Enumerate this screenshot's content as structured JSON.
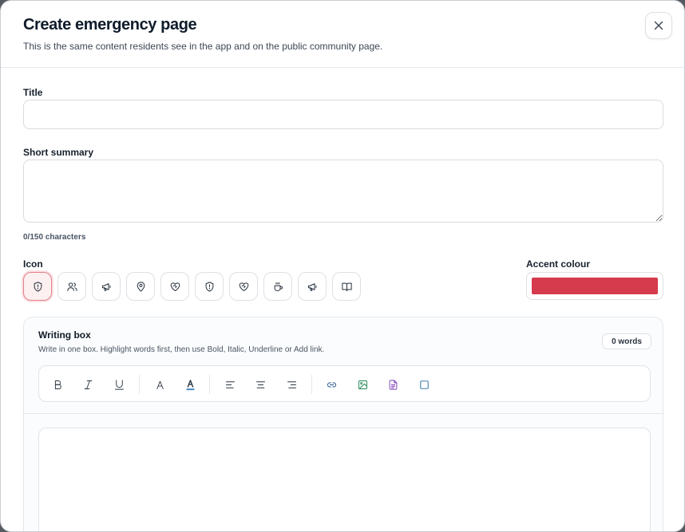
{
  "modal": {
    "title": "Create emergency page",
    "subtitle": "This is the same content residents see in the app and on the public community page."
  },
  "form": {
    "title_label": "Title",
    "title_value": "",
    "summary_label": "Short summary",
    "summary_value": "",
    "char_count": "0/150 characters",
    "icon_label": "Icon",
    "accent_label": "Accent colour",
    "accent_color": "#d63a4d",
    "icons": [
      {
        "name": "shield-alert-icon",
        "selected": true
      },
      {
        "name": "users-icon",
        "selected": false
      },
      {
        "name": "megaphone-icon",
        "selected": false
      },
      {
        "name": "map-pin-icon",
        "selected": false
      },
      {
        "name": "heart-handshake-icon",
        "selected": false
      },
      {
        "name": "shield-alert-icon",
        "selected": false
      },
      {
        "name": "heart-handshake-icon",
        "selected": false
      },
      {
        "name": "coffee-icon",
        "selected": false
      },
      {
        "name": "megaphone-icon",
        "selected": false
      },
      {
        "name": "book-open-icon",
        "selected": false
      }
    ]
  },
  "writing_box": {
    "title": "Writing box",
    "subtitle": "Write in one box. Highlight words first, then use Bold, Italic, Underline or Add link.",
    "word_count": "0 words",
    "toolbar": [
      {
        "name": "bold-icon",
        "glyph": "B"
      },
      {
        "name": "italic-icon",
        "glyph": "I"
      },
      {
        "name": "underline-icon",
        "glyph": "U"
      },
      {
        "name": "font-size-icon",
        "glyph": "A"
      },
      {
        "name": "text-color-icon",
        "glyph": "A"
      },
      {
        "name": "align-left-icon"
      },
      {
        "name": "align-center-icon"
      },
      {
        "name": "align-right-icon"
      },
      {
        "name": "link-icon"
      },
      {
        "name": "image-icon"
      },
      {
        "name": "document-icon"
      },
      {
        "name": "box-icon"
      }
    ],
    "text_color_accent": "#3b82c4",
    "image_icon_color": "#1f8a55",
    "document_icon_color": "#7b3fb8",
    "box_icon_color": "#1f6f9a",
    "link_icon_color": "#1f4f8a",
    "editor_value": ""
  }
}
